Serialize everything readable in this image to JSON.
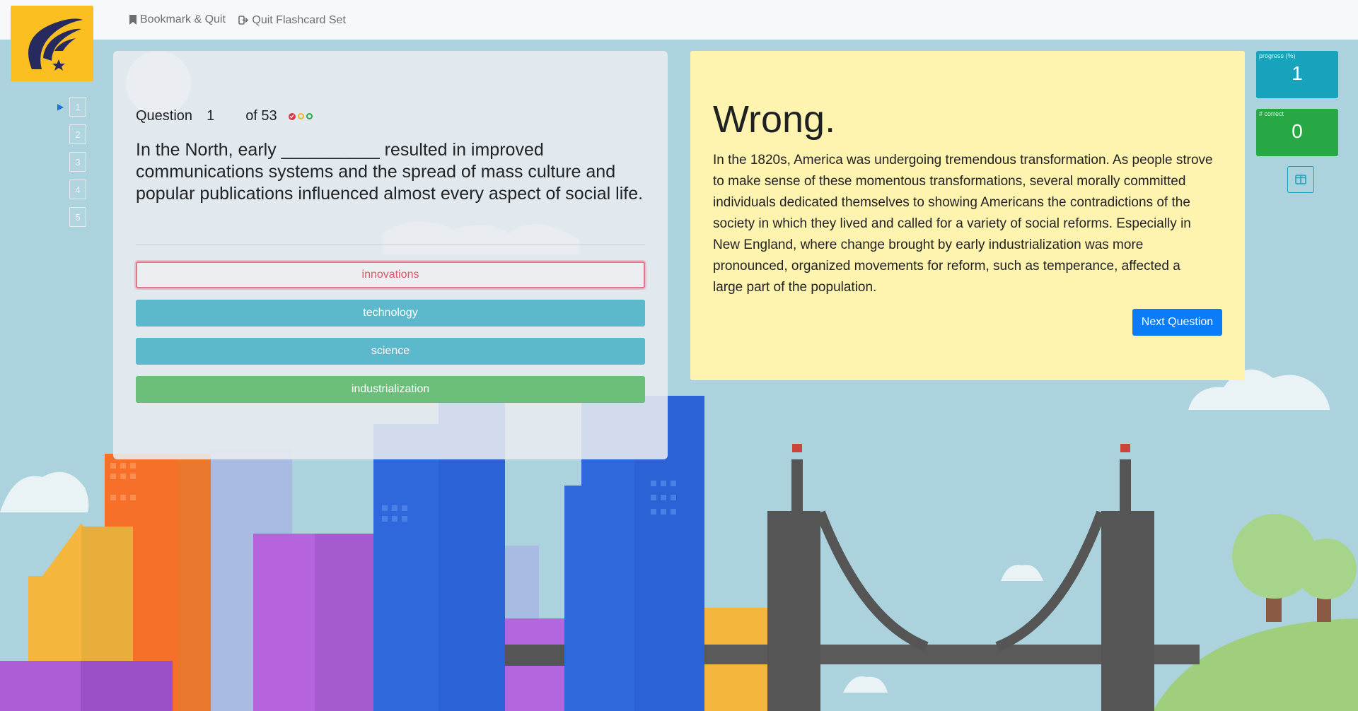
{
  "nav": {
    "bookmark_label": "Bookmark & Quit",
    "quit_label": "Quit Flashcard Set"
  },
  "question_list": [
    "1",
    "2",
    "3",
    "4",
    "5"
  ],
  "question": {
    "label": "Question",
    "number": "1",
    "total": "of 53",
    "text": "In the North, early __________ resulted in improved communications systems and the spread of mass culture and popular publications influenced almost every aspect of social life.",
    "answers": [
      {
        "label": "innovations",
        "state": "wrong"
      },
      {
        "label": "technology",
        "state": "neutral"
      },
      {
        "label": "science",
        "state": "neutral"
      },
      {
        "label": "industrialization",
        "state": "correct"
      }
    ]
  },
  "feedback": {
    "title": "Wrong.",
    "text": "In the 1820s, America was undergoing tremendous transformation. As people strove to make sense of these momentous transformations, several morally committed individuals dedicated themselves to showing Americans the contradictions of the society in which they lived and called for a variety of social reforms. Especially in New England, where change brought by early industrialization was more pronounced, organized movements for reform, such as temperance, affected a large part of the population.",
    "next_label": "Next Question"
  },
  "stats": {
    "progress_label": "progress (%)",
    "progress_value": "1",
    "correct_label": "# correct",
    "correct_value": "0"
  },
  "colors": {
    "accent": "#0a7cf7",
    "progress": "#18a3bc",
    "correct": "#28a745",
    "feedback_bg": "#fff3b0",
    "logo_bg": "#fbbf22"
  },
  "icons": {
    "bookmark": "bookmark-icon",
    "quit": "sign-out-icon",
    "toggle": "columns-icon",
    "current": "triangle-right-icon"
  }
}
